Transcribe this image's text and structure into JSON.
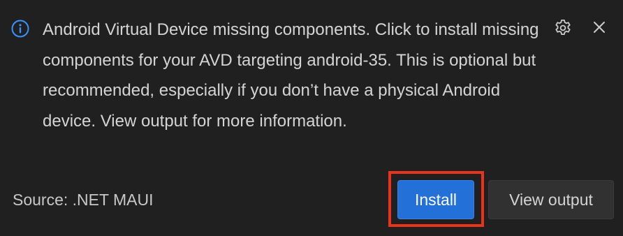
{
  "notification": {
    "icon": "info-icon",
    "message": "Android Virtual Device missing components. Click to install missing components for your AVD targeting android-35. This is optional but recommended, especially if you don’t have a physical Android device. View output for more information.",
    "source": "Source: .NET MAUI",
    "settings_icon": "gear-icon",
    "close_icon": "close-icon"
  },
  "actions": {
    "install_label": "Install",
    "view_output_label": "View output"
  },
  "colors": {
    "background": "#202020",
    "info_accent": "#3794ff",
    "primary_button": "#2371d8",
    "secondary_button": "#313131",
    "highlight_border": "#e8341c"
  }
}
